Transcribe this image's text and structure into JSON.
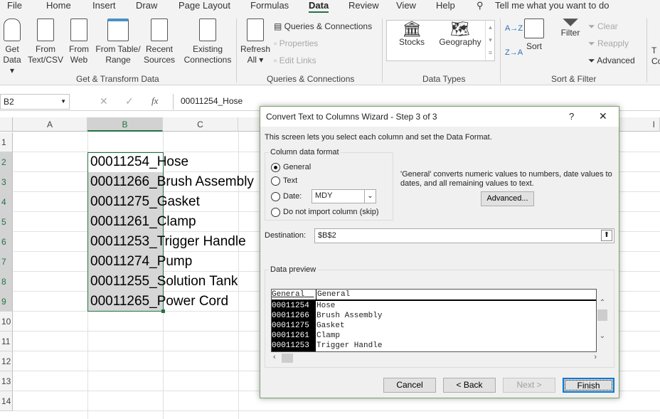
{
  "ribbon_tabs": [
    "File",
    "Home",
    "Insert",
    "Draw",
    "Page Layout",
    "Formulas",
    "Data",
    "Review",
    "View",
    "Help"
  ],
  "active_tab": "Data",
  "tell_me": "Tell me what you want to do",
  "get_transform": {
    "get_data": [
      "Get",
      "Data ▾"
    ],
    "from_text": [
      "From",
      "Text/CSV"
    ],
    "from_web": [
      "From",
      "Web"
    ],
    "from_table": [
      "From Table/",
      "Range"
    ],
    "recent": [
      "Recent",
      "Sources"
    ],
    "existing": [
      "Existing",
      "Connections"
    ],
    "group": "Get & Transform Data"
  },
  "queries": {
    "refresh": [
      "Refresh",
      "All ▾"
    ],
    "queries_connections": "Queries & Connections",
    "properties": "Properties",
    "edit_links": "Edit Links",
    "group": "Queries & Connections"
  },
  "data_types": {
    "stocks": "Stocks",
    "geography": "Geography",
    "group": "Data Types"
  },
  "sort_filter": {
    "sort": "Sort",
    "filter": "Filter",
    "clear": "Clear",
    "reapply": "Reapply",
    "advanced": "Advanced",
    "group": "Sort & Filter",
    "az": "A→Z",
    "za": "Z→A"
  },
  "cut_off": [
    "T",
    "Co"
  ],
  "formula_bar": {
    "name_box": "B2",
    "fx": "fx",
    "value": "00011254_Hose"
  },
  "columns": [
    "A",
    "B",
    "C",
    "I"
  ],
  "rows": [
    "1",
    "2",
    "3",
    "4",
    "5",
    "6",
    "7",
    "8",
    "9",
    "10",
    "11",
    "12",
    "13",
    "14"
  ],
  "cells_b": [
    "00011254_Hose",
    "00011266_Brush Assembly",
    "00011275_Gasket",
    "00011261_Clamp",
    "00011253_Trigger Handle",
    "00011274_Pump",
    "00011255_Solution Tank",
    "00011265_Power Cord"
  ],
  "dialog": {
    "title": "Convert Text to Columns Wizard - Step 3 of 3",
    "help": "?",
    "close": "✕",
    "intro": "This screen lets you select each column and set the Data Format.",
    "format_group": "Column data format",
    "options": [
      "General",
      "Text",
      "Date:",
      "Do not import column (skip)"
    ],
    "selected_option": "General",
    "date_value": "MDY",
    "description": "'General' converts numeric values to numbers, date values to dates, and all remaining values to text.",
    "advanced": "Advanced...",
    "destination_label": "Destination:",
    "destination_value": "$B$2",
    "preview_label": "Data preview",
    "preview_headers": [
      "General",
      "General"
    ],
    "preview_rows": [
      [
        "00011254",
        "Hose"
      ],
      [
        "00011266",
        "Brush Assembly"
      ],
      [
        "00011275",
        "Gasket"
      ],
      [
        "00011261",
        "Clamp"
      ],
      [
        "00011253",
        "Trigger Handle"
      ]
    ],
    "buttons": {
      "cancel": "Cancel",
      "back": "< Back",
      "next": "Next >",
      "finish": "Finish"
    }
  },
  "colors": {
    "accent": "#217346",
    "selection": "#d6d6d6"
  }
}
